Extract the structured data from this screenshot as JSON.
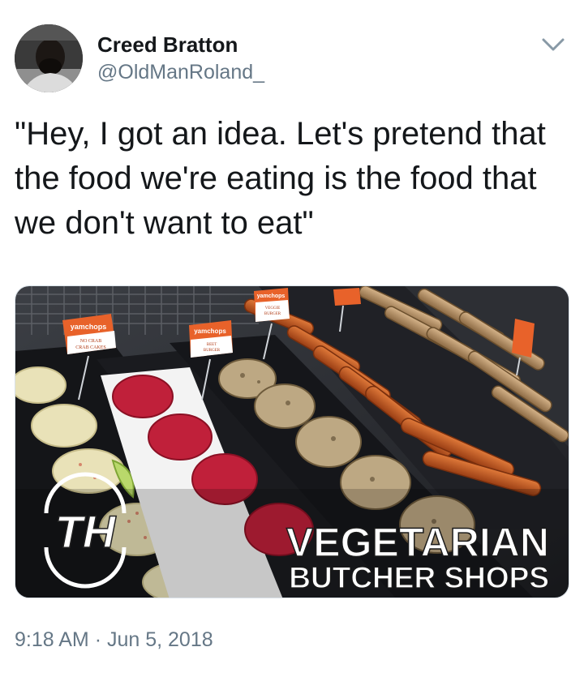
{
  "tweet": {
    "author_name": "Creed Bratton",
    "author_handle": "@OldManRoland_",
    "text": "\"Hey, I got an idea. Let's pretend that the food we're eating is the food that we don't want to eat\"",
    "time": "9:18 AM",
    "separator": "·",
    "date": "Jun 5, 2018"
  },
  "media": {
    "logo": "TH",
    "headline_line1": "VEGETARIAN",
    "headline_line2": "BUTCHER SHOPS",
    "price_tags": [
      {
        "brand": "yamchops",
        "line1": "NO CRAB",
        "line2": "CRAB CAKES"
      },
      {
        "brand": "yamchops",
        "line1": "BEET",
        "line2": "BURGER"
      },
      {
        "brand": "yamchops",
        "line1": "VEGGIE",
        "line2": "BURGER"
      }
    ]
  },
  "icons": {
    "caret": "chevron-down-icon"
  },
  "colors": {
    "text_primary": "#14171a",
    "text_secondary": "#657786",
    "tag_orange": "#e8622a"
  }
}
